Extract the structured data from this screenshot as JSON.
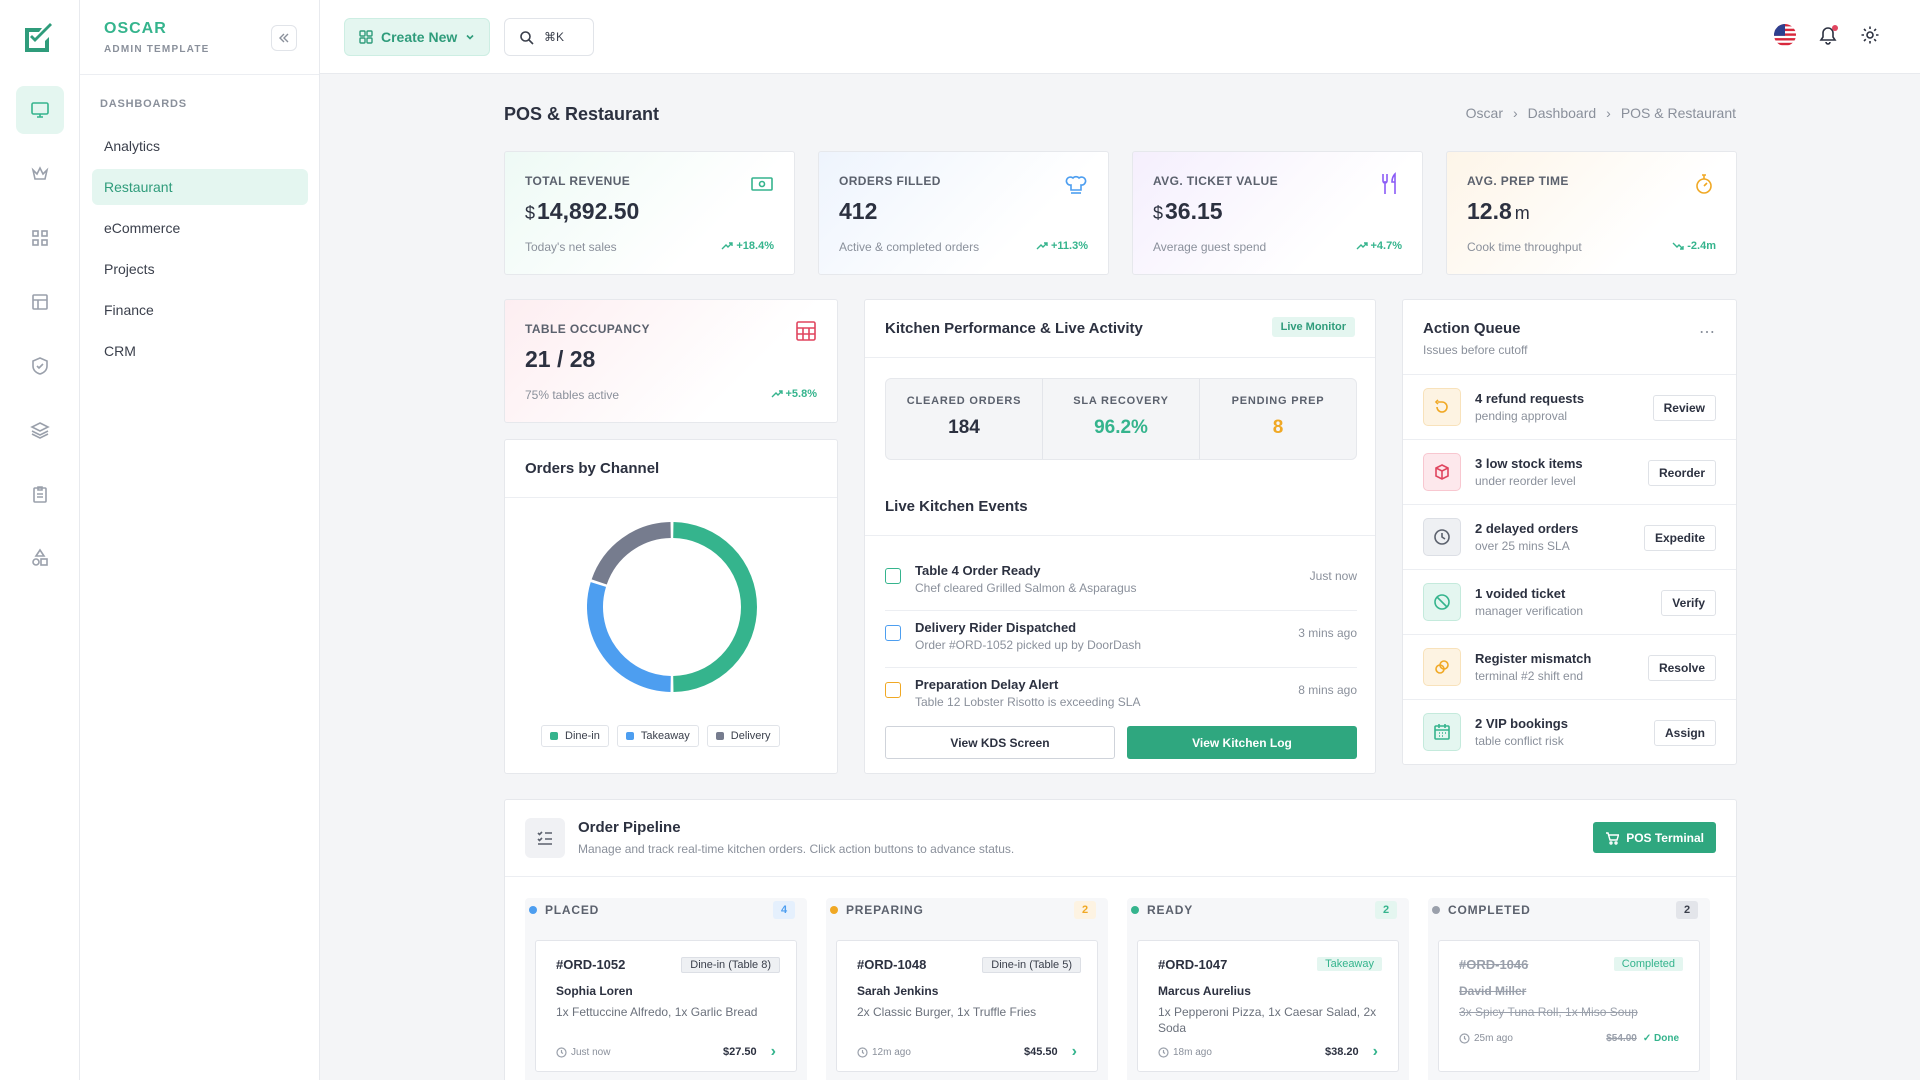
{
  "brand": {
    "name": "OSCAR",
    "subtitle": "ADMIN TEMPLATE"
  },
  "sidebar": {
    "section": "DASHBOARDS",
    "items": [
      {
        "label": "Analytics"
      },
      {
        "label": "Restaurant"
      },
      {
        "label": "eCommerce"
      },
      {
        "label": "Projects"
      },
      {
        "label": "Finance"
      },
      {
        "label": "CRM"
      }
    ]
  },
  "topbar": {
    "create_label": "Create New",
    "search_shortcut": "⌘K"
  },
  "page": {
    "title": "POS & Restaurant",
    "breadcrumb": [
      "Oscar",
      "Dashboard",
      "POS & Restaurant"
    ]
  },
  "stats": [
    {
      "label": "TOTAL REVENUE",
      "currency": "$",
      "value": "14,892.50",
      "sub": "Today's net sales",
      "trend": "+18.4%",
      "icon": "cash-icon",
      "color": "#35b48d"
    },
    {
      "label": "ORDERS FILLED",
      "value": "412",
      "sub": "Active & completed orders",
      "trend": "+11.3%",
      "icon": "chef-hat-icon",
      "color": "#4d9ef0"
    },
    {
      "label": "AVG. TICKET VALUE",
      "currency": "$",
      "value": "36.15",
      "sub": "Average guest spend",
      "trend": "+4.7%",
      "icon": "utensils-icon",
      "color": "#8b5cf6"
    },
    {
      "label": "AVG. PREP TIME",
      "value": "12.8",
      "unit": "m",
      "sub": "Cook time throughput",
      "trend": "-2.4m",
      "icon": "stopwatch-icon",
      "color": "#f0a824"
    },
    {
      "label": "TABLE OCCUPANCY",
      "value": "21 / 28",
      "sub": "75% tables active",
      "trend": "+5.8%",
      "icon": "table-grid-icon",
      "color": "#e0455f"
    }
  ],
  "orders_by_channel": {
    "title": "Orders by Channel"
  },
  "chart_data": {
    "type": "pie",
    "donut": true,
    "labels": [
      "Dine-in",
      "Takeaway",
      "Delivery"
    ],
    "values": [
      50,
      30,
      20
    ],
    "colors": [
      "#35b48d",
      "#4d9ef0",
      "#767c8e"
    ]
  },
  "kitchen": {
    "title": "Kitchen Performance & Live Activity",
    "badge": "Live Monitor",
    "stats": [
      {
        "label": "CLEARED ORDERS",
        "value": "184",
        "color": "#2c3140"
      },
      {
        "label": "SLA RECOVERY",
        "value": "96.2%",
        "color": "#35b48d"
      },
      {
        "label": "PENDING PREP",
        "value": "8",
        "color": "#f0a824"
      }
    ],
    "events_title": "Live Kitchen Events",
    "events": [
      {
        "title": "Table 4 Order Ready",
        "sub": "Chef cleared Grilled Salmon & Asparagus",
        "time": "Just now",
        "color": "#35b48d"
      },
      {
        "title": "Delivery Rider Dispatched",
        "sub": "Order #ORD-1052 picked up by DoorDash",
        "time": "3 mins ago",
        "color": "#4d9ef0"
      },
      {
        "title": "Preparation Delay Alert",
        "sub": "Table 12 Lobster Risotto is exceeding SLA",
        "time": "8 mins ago",
        "color": "#f0a824"
      }
    ],
    "btn_kds": "View KDS Screen",
    "btn_log": "View Kitchen Log"
  },
  "action_queue": {
    "title": "Action Queue",
    "subtitle": "Issues before cutoff",
    "items": [
      {
        "title": "4 refund requests",
        "sub": "pending approval",
        "button": "Review",
        "icon": "undo-icon",
        "color": "#f0a824",
        "bg": "#fdf3e2"
      },
      {
        "title": "3 low stock items",
        "sub": "under reorder level",
        "button": "Reorder",
        "icon": "box-icon",
        "color": "#e0455f",
        "bg": "#fde8ec"
      },
      {
        "title": "2 delayed orders",
        "sub": "over 25 mins SLA",
        "button": "Expedite",
        "icon": "clock-icon",
        "color": "#5b616d",
        "bg": "#eef0f3"
      },
      {
        "title": "1 voided ticket",
        "sub": "manager verification",
        "button": "Verify",
        "icon": "ban-icon",
        "color": "#35b48d",
        "bg": "#e4f6f0"
      },
      {
        "title": "Register mismatch",
        "sub": "terminal #2 shift end",
        "button": "Resolve",
        "icon": "coins-icon",
        "color": "#f0a824",
        "bg": "#fdf3e2"
      },
      {
        "title": "2 VIP bookings",
        "sub": "table conflict risk",
        "button": "Assign",
        "icon": "calendar-icon",
        "color": "#35b48d",
        "bg": "#e4f6f0"
      }
    ]
  },
  "pipeline": {
    "title": "Order Pipeline",
    "subtitle": "Manage and track real-time kitchen orders. Click action buttons to advance status.",
    "pos_button": "POS Terminal",
    "columns": [
      {
        "name": "PLACED",
        "count": "4",
        "color": "#4d9ef0",
        "order": {
          "id": "#ORD-1052",
          "tag": "Dine-in (Table 8)",
          "customer": "Sophia Loren",
          "items": "1x Fettuccine Alfredo, 1x Garlic Bread",
          "age": "Just now",
          "price": "$27.50"
        }
      },
      {
        "name": "PREPARING",
        "count": "2",
        "color": "#f0a824",
        "order": {
          "id": "#ORD-1048",
          "tag": "Dine-in (Table 5)",
          "customer": "Sarah Jenkins",
          "items": "2x Classic Burger, 1x Truffle Fries",
          "age": "12m ago",
          "price": "$45.50"
        }
      },
      {
        "name": "READY",
        "count": "2",
        "color": "#35b48d",
        "order": {
          "id": "#ORD-1047",
          "tag": "Takeaway",
          "customer": "Marcus Aurelius",
          "items": "1x Pepperoni Pizza, 1x Caesar Salad, 2x Soda",
          "age": "18m ago",
          "price": "$38.20"
        }
      },
      {
        "name": "COMPLETED",
        "count": "2",
        "color": "#9aa0ab",
        "order": {
          "id": "#ORD-1046",
          "tag": "Completed",
          "customer": "David Miller",
          "items": "3x Spicy Tuna Roll, 1x Miso Soup",
          "age": "25m ago",
          "price": "$54.00",
          "status": "Done"
        }
      }
    ]
  }
}
